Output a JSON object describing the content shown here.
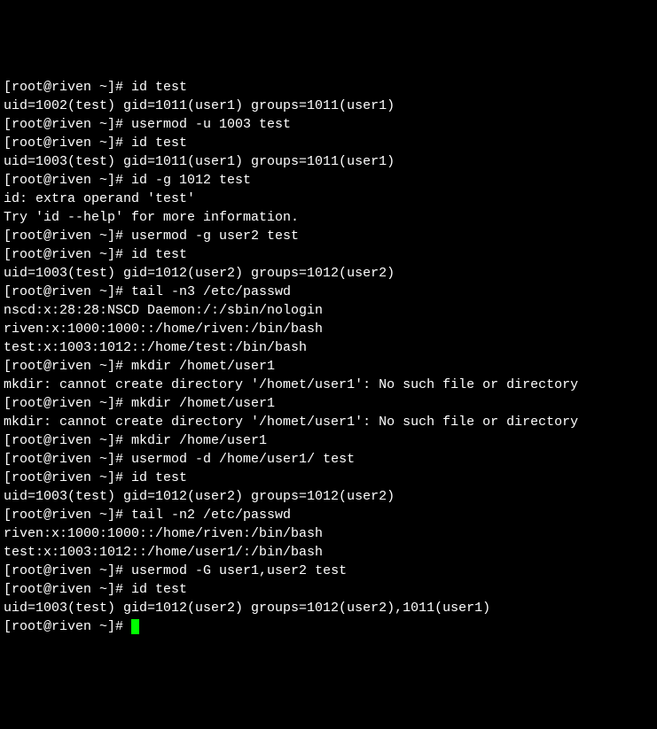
{
  "prompt": "[root@riven ~]# ",
  "lines": [
    {
      "type": "cmd",
      "text": "id test"
    },
    {
      "type": "out",
      "text": "uid=1002(test) gid=1011(user1) groups=1011(user1)"
    },
    {
      "type": "cmd",
      "text": "usermod -u 1003 test"
    },
    {
      "type": "cmd",
      "text": "id test"
    },
    {
      "type": "out",
      "text": "uid=1003(test) gid=1011(user1) groups=1011(user1)"
    },
    {
      "type": "cmd",
      "text": "id -g 1012 test"
    },
    {
      "type": "out",
      "text": "id: extra operand 'test'"
    },
    {
      "type": "out",
      "text": "Try 'id --help' for more information."
    },
    {
      "type": "cmd",
      "text": "usermod -g user2 test"
    },
    {
      "type": "cmd",
      "text": "id test"
    },
    {
      "type": "out",
      "text": "uid=1003(test) gid=1012(user2) groups=1012(user2)"
    },
    {
      "type": "cmd",
      "text": "tail -n3 /etc/passwd"
    },
    {
      "type": "out",
      "text": "nscd:x:28:28:NSCD Daemon:/:/sbin/nologin"
    },
    {
      "type": "out",
      "text": "riven:x:1000:1000::/home/riven:/bin/bash"
    },
    {
      "type": "out",
      "text": "test:x:1003:1012::/home/test:/bin/bash"
    },
    {
      "type": "cmd",
      "text": "mkdir /homet/user1"
    },
    {
      "type": "out",
      "text": "mkdir: cannot create directory '/homet/user1': No such file or directory"
    },
    {
      "type": "cmd",
      "text": "mkdir /homet/user1"
    },
    {
      "type": "out",
      "text": "mkdir: cannot create directory '/homet/user1': No such file or directory"
    },
    {
      "type": "cmd",
      "text": "mkdir /home/user1"
    },
    {
      "type": "cmd",
      "text": "usermod -d /home/user1/ test"
    },
    {
      "type": "cmd",
      "text": "id test"
    },
    {
      "type": "out",
      "text": "uid=1003(test) gid=1012(user2) groups=1012(user2)"
    },
    {
      "type": "cmd",
      "text": "tail -n2 /etc/passwd"
    },
    {
      "type": "out",
      "text": "riven:x:1000:1000::/home/riven:/bin/bash"
    },
    {
      "type": "out",
      "text": "test:x:1003:1012::/home/user1/:/bin/bash"
    },
    {
      "type": "cmd",
      "text": "usermod -G user1,user2 test"
    },
    {
      "type": "cmd",
      "text": "id test"
    },
    {
      "type": "out",
      "text": "uid=1003(test) gid=1012(user2) groups=1012(user2),1011(user1)"
    }
  ],
  "final_prompt": true
}
